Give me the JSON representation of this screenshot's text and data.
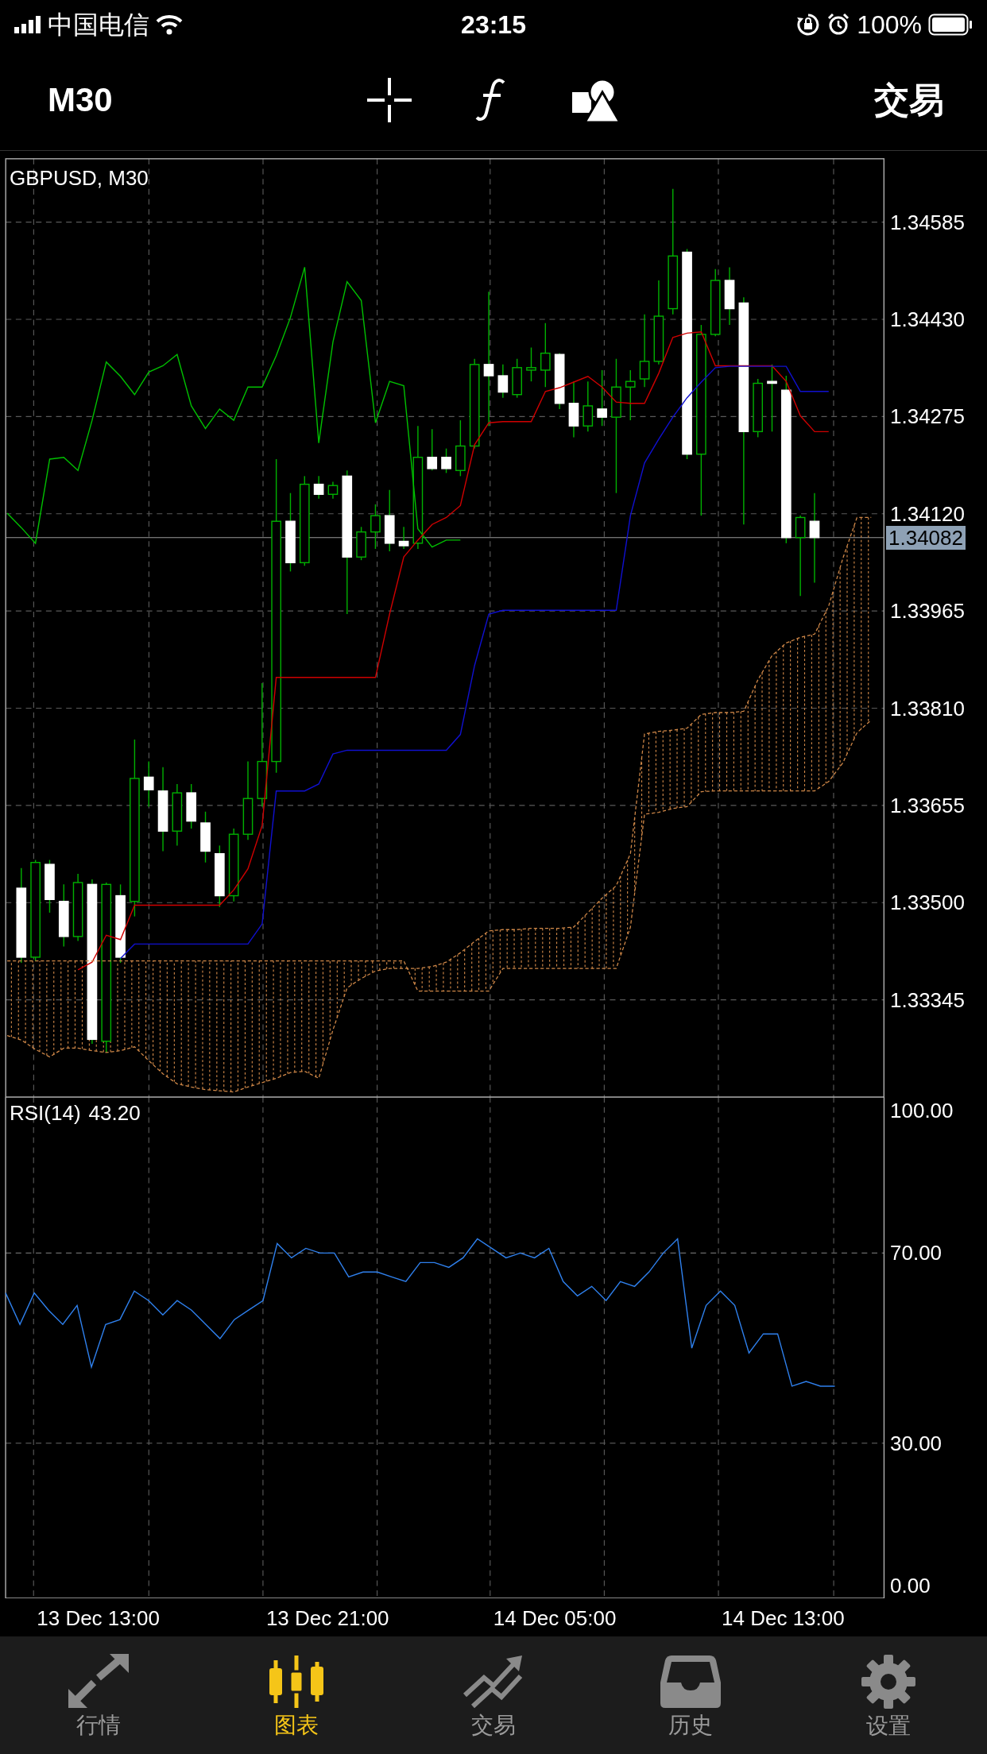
{
  "status_bar": {
    "carrier": "中国电信",
    "time": "23:15",
    "battery": "100%"
  },
  "toolbar": {
    "timeframe": "M30",
    "action": "交易"
  },
  "price_chart": {
    "symbol": "GBPUSD, M30",
    "chart_data": {
      "type": "candlestick",
      "grid": true,
      "ylim": [
        1.3319,
        1.34686
      ],
      "yticks": [
        {
          "value": 1.34585,
          "label": "1.34585"
        },
        {
          "value": 1.3443,
          "label": "1.34430"
        },
        {
          "value": 1.34275,
          "label": "1.34275"
        },
        {
          "value": 1.3412,
          "label": "1.34120"
        },
        {
          "value": 1.33965,
          "label": "1.33965"
        },
        {
          "value": 1.3381,
          "label": "1.33810"
        },
        {
          "value": 1.33655,
          "label": "1.33655"
        },
        {
          "value": 1.335,
          "label": "1.33500"
        },
        {
          "value": 1.33345,
          "label": "1.33345"
        }
      ],
      "ref_lines": [
        {
          "axis": "y",
          "value": 1.34082,
          "label": "1.34082"
        }
      ],
      "categories": [
        null,
        null,
        null,
        null,
        null,
        null,
        null,
        null,
        null,
        null,
        null,
        null,
        null,
        null,
        null,
        null,
        null,
        null,
        null,
        null,
        null,
        null,
        null,
        null,
        null,
        null,
        null,
        null,
        null,
        null,
        null,
        null,
        null,
        null,
        null,
        null,
        null,
        null,
        null,
        null,
        null,
        null,
        null,
        null,
        null,
        null,
        null,
        null,
        null,
        null,
        null,
        null,
        null,
        null,
        null,
        null,
        null,
        null,
        null,
        null,
        null,
        null
      ],
      "ohlc": [
        null,
        [
          1.33523,
          1.33555,
          1.33404,
          1.33413
        ],
        [
          1.33413,
          1.33568,
          1.33407,
          1.33564
        ],
        [
          1.33561,
          1.33568,
          1.33484,
          1.33505
        ],
        [
          1.33502,
          1.33529,
          1.3343,
          1.33446
        ],
        [
          1.33446,
          1.33546,
          1.33439,
          1.33532
        ],
        [
          1.33529,
          1.33537,
          1.33275,
          1.33282
        ],
        [
          1.33279,
          1.33532,
          1.33261,
          1.33529
        ],
        [
          1.33511,
          1.33529,
          1.33404,
          1.33413
        ],
        [
          1.33502,
          1.3376,
          1.33478,
          1.33698
        ],
        [
          1.337,
          1.33725,
          1.33653,
          1.3368
        ],
        [
          1.33678,
          1.33716,
          1.33582,
          1.33614
        ],
        [
          1.33614,
          1.33689,
          1.33591,
          1.33675
        ],
        [
          1.33675,
          1.33689,
          1.33618,
          1.3363
        ],
        [
          1.33627,
          1.33645,
          1.33564,
          1.33582
        ],
        [
          1.33578,
          1.33591,
          1.33493,
          1.33511
        ],
        [
          1.33511,
          1.33618,
          1.33502,
          1.33609
        ],
        [
          1.33609,
          1.33725,
          1.336,
          1.33666
        ],
        [
          1.33666,
          1.3385,
          1.33653,
          1.33725
        ],
        [
          1.33725,
          1.34207,
          1.33707,
          1.34108
        ],
        [
          1.34108,
          1.34153,
          1.34028,
          1.34042
        ],
        [
          1.34042,
          1.3418,
          1.34037,
          1.34167
        ],
        [
          1.34167,
          1.3418,
          1.34144,
          1.34151
        ],
        [
          1.34151,
          1.34171,
          1.34144,
          1.34165
        ],
        [
          1.3418,
          1.34189,
          1.3396,
          1.34051
        ],
        [
          1.34051,
          1.34099,
          1.34046,
          1.34091
        ],
        [
          1.34091,
          1.34135,
          1.34064,
          1.34117
        ],
        [
          1.34117,
          1.34158,
          1.3406,
          1.34073
        ],
        [
          1.34076,
          1.34099,
          1.34064,
          1.34069
        ],
        [
          1.34073,
          1.3426,
          1.34064,
          1.3421
        ],
        [
          1.3421,
          1.34255,
          1.34189,
          1.34192
        ],
        [
          1.3421,
          1.34224,
          1.34185,
          1.34192
        ],
        [
          1.34189,
          1.34269,
          1.3418,
          1.34228
        ],
        [
          1.34228,
          1.34367,
          1.34224,
          1.34358
        ],
        [
          1.34358,
          1.34474,
          1.3426,
          1.3434
        ],
        [
          1.3434,
          1.34358,
          1.34305,
          1.34314
        ],
        [
          1.3431,
          1.34367,
          1.34305,
          1.34353
        ],
        [
          1.34349,
          1.34385,
          1.34331,
          1.34353
        ],
        [
          1.34349,
          1.34424,
          1.34322,
          1.34376
        ],
        [
          1.34374,
          1.34376,
          1.34287,
          1.34296
        ],
        [
          1.34296,
          1.34331,
          1.34242,
          1.3426
        ],
        [
          1.3426,
          1.34331,
          1.34251,
          1.34292
        ],
        [
          1.34287,
          1.34349,
          1.3426,
          1.34274
        ],
        [
          1.34274,
          1.34367,
          1.34153,
          1.34322
        ],
        [
          1.34322,
          1.34349,
          1.34269,
          1.34331
        ],
        [
          1.34335,
          1.34438,
          1.34322,
          1.34363
        ],
        [
          1.34363,
          1.34492,
          1.34358,
          1.34435
        ],
        [
          1.34447,
          1.34638,
          1.34438,
          1.34531
        ],
        [
          1.34537,
          1.34542,
          1.34207,
          1.34215
        ],
        [
          1.34215,
          1.34421,
          1.34117,
          1.34406
        ],
        [
          1.34406,
          1.3451,
          1.34403,
          1.34492
        ],
        [
          1.34492,
          1.34513,
          1.34421,
          1.34447
        ],
        [
          1.34456,
          1.34465,
          1.34103,
          1.34251
        ],
        [
          1.34251,
          1.34335,
          1.34242,
          1.34328
        ],
        [
          1.34331,
          1.34358,
          1.34251,
          1.34328
        ],
        [
          1.34317,
          1.3434,
          1.34073,
          1.34082
        ],
        [
          1.34082,
          1.34117,
          1.33989,
          1.34114
        ],
        [
          1.34108,
          1.34153,
          1.3401,
          1.34082
        ],
        null,
        null,
        null,
        null
      ],
      "series": [
        {
          "type": "line",
          "color": "#00c000",
          "values": [
            1.34121,
            1.34098,
            1.34073,
            1.34207,
            1.3421,
            1.34189,
            1.34269,
            1.34362,
            1.34339,
            1.3431,
            1.34346,
            1.34356,
            1.34374,
            1.34292,
            1.34256,
            1.34287,
            1.34269,
            1.34322,
            1.34322,
            1.34372,
            1.34433,
            1.34513,
            1.34233,
            1.34394,
            1.3449,
            1.3446,
            1.34265,
            1.34331,
            1.34324,
            1.34096,
            1.34067,
            1.34078,
            1.34078,
            null,
            null,
            null,
            null,
            null,
            null,
            null,
            null,
            null,
            null,
            null,
            null,
            null,
            null,
            null,
            null,
            null,
            null,
            null,
            null,
            null,
            null,
            null,
            null,
            null,
            null,
            null,
            null,
            null
          ]
        },
        {
          "type": "line",
          "color": "#d00000",
          "values": [
            null,
            null,
            null,
            null,
            null,
            1.33393,
            1.33405,
            1.33448,
            1.33441,
            1.33496,
            1.33496,
            1.33496,
            1.33496,
            1.33496,
            1.33496,
            1.33496,
            1.3352,
            1.33554,
            1.33623,
            1.33859,
            1.33859,
            1.33859,
            1.33859,
            1.33859,
            1.33859,
            1.33859,
            1.33859,
            1.3396,
            1.34051,
            1.34078,
            1.34103,
            1.34114,
            1.34133,
            1.3423,
            1.34265,
            1.34267,
            1.34267,
            1.34267,
            1.34315,
            1.34321,
            1.3433,
            1.34339,
            1.34322,
            1.34298,
            1.34296,
            1.34296,
            1.34344,
            1.34401,
            1.34408,
            1.3441,
            1.34356,
            1.34356,
            1.34356,
            1.34356,
            1.34356,
            1.34331,
            1.34276,
            1.34251,
            1.34251,
            null,
            null,
            null
          ]
        },
        {
          "type": "line",
          "color": "#1010d0",
          "values": [
            null,
            null,
            null,
            null,
            null,
            null,
            null,
            null,
            1.33411,
            1.33434,
            1.33434,
            1.33434,
            1.33434,
            1.33434,
            1.33434,
            1.33434,
            1.33434,
            1.33434,
            1.33466,
            1.33678,
            1.33678,
            1.33678,
            1.33689,
            1.33737,
            1.33743,
            1.33743,
            1.33743,
            1.33743,
            1.33743,
            1.33743,
            1.33743,
            1.33743,
            1.33768,
            1.33878,
            1.3396,
            1.33966,
            1.33966,
            1.33966,
            1.33966,
            1.33966,
            1.33966,
            1.33966,
            1.33966,
            1.33966,
            1.34117,
            1.34201,
            1.34239,
            1.34274,
            1.34305,
            1.3433,
            1.34353,
            1.34355,
            1.34355,
            1.34355,
            1.34355,
            1.34355,
            1.34315,
            1.34315,
            1.34315,
            null,
            null,
            null
          ]
        },
        {
          "type": "line",
          "color": "#d08848",
          "line_style": "dashed",
          "values": [
            1.33288,
            1.33281,
            1.33266,
            1.33254,
            1.33268,
            1.33268,
            1.33264,
            1.33261,
            1.33264,
            1.3327,
            1.33248,
            1.33227,
            1.33211,
            1.33206,
            1.33202,
            1.332,
            1.33198,
            1.33206,
            1.33213,
            1.3322,
            1.33229,
            1.33231,
            1.3322,
            1.33297,
            1.33364,
            1.33379,
            1.33391,
            1.33395,
            1.33395,
            1.33395,
            1.33398,
            1.33405,
            1.3342,
            1.33438,
            1.33455,
            1.33457,
            1.33457,
            1.33459,
            1.33459,
            1.33459,
            1.33461,
            1.33484,
            1.33507,
            1.33527,
            1.33578,
            1.33769,
            1.33773,
            1.33775,
            1.33778,
            1.338,
            1.33803,
            1.33803,
            1.33805,
            1.33855,
            1.33894,
            1.33914,
            1.33923,
            1.33928,
            1.33973,
            1.34049,
            1.34114,
            1.34114
          ]
        },
        {
          "type": "line",
          "color": "#d08848",
          "line_style": "dashed",
          "values": [
            1.33407,
            1.33407,
            1.33407,
            1.33407,
            1.33407,
            1.33407,
            1.33407,
            1.33407,
            1.33407,
            1.33407,
            1.33407,
            1.33407,
            1.33407,
            1.33407,
            1.33407,
            1.33407,
            1.33407,
            1.33407,
            1.33407,
            1.33407,
            1.33407,
            1.33407,
            1.33407,
            1.33407,
            1.33407,
            1.33407,
            1.33407,
            1.33407,
            1.33407,
            1.33359,
            1.33359,
            1.33359,
            1.33359,
            1.33359,
            1.33359,
            1.33395,
            1.33395,
            1.33395,
            1.33395,
            1.33395,
            1.33395,
            1.33395,
            1.33395,
            1.33395,
            1.33461,
            1.33641,
            1.33644,
            1.3365,
            1.33653,
            1.33677,
            1.33678,
            1.33678,
            1.33678,
            1.33678,
            1.33678,
            1.33678,
            1.33678,
            1.33678,
            1.33693,
            1.33723,
            1.33771,
            1.33791
          ]
        }
      ]
    }
  },
  "rsi_panel": {
    "current_value": "43.20",
    "chart_data": {
      "type": "line",
      "grid": true,
      "ylim": [
        -2.6,
        102.8
      ],
      "yticks": [
        {
          "value": 100,
          "label": "100.00"
        },
        {
          "value": 70,
          "label": "70.00"
        },
        {
          "value": 30,
          "label": "30.00"
        },
        {
          "value": 0,
          "label": "0.00"
        }
      ],
      "series": [
        {
          "name": "RSI(14)",
          "color": "#2f80ed",
          "values": [
            61.6,
            55,
            61.6,
            58,
            55,
            59,
            46,
            55,
            56,
            62,
            60,
            57,
            60,
            58,
            55,
            52,
            56,
            58,
            60,
            72,
            69,
            71,
            70,
            70,
            65,
            66,
            66,
            65,
            64,
            68,
            68,
            67,
            69,
            73,
            71,
            69,
            70,
            69,
            71,
            64,
            61,
            63,
            60,
            64,
            63,
            66,
            70,
            73,
            50,
            59,
            62,
            59,
            49,
            53,
            53,
            42,
            43,
            42,
            42
          ]
        }
      ]
    }
  },
  "time_axis": [
    "13 Dec 13:00",
    "13 Dec 21:00",
    "14 Dec 05:00",
    "14 Dec 13:00"
  ],
  "tab_bar": [
    {
      "label": "行情",
      "selected": false
    },
    {
      "label": "图表",
      "selected": true
    },
    {
      "label": "交易",
      "selected": false
    },
    {
      "label": "历史",
      "selected": false
    },
    {
      "label": "设置",
      "selected": false
    }
  ]
}
